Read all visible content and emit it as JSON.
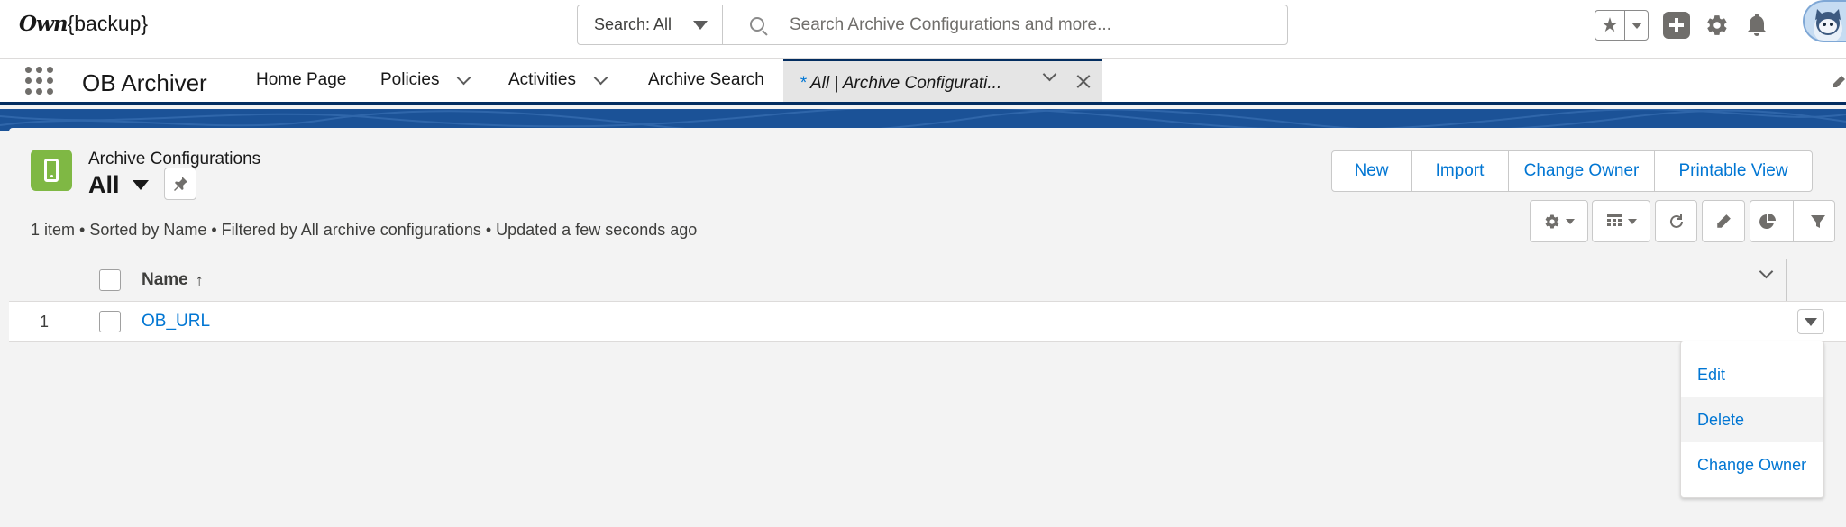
{
  "brand": {
    "logo_own": "Own",
    "logo_backup": "{backup}"
  },
  "search": {
    "scope": "Search: All",
    "placeholder": "Search Archive Configurations and more..."
  },
  "app": {
    "name": "OB Archiver"
  },
  "nav": {
    "items": [
      {
        "label": "Home Page",
        "has_menu": false
      },
      {
        "label": "Policies",
        "has_menu": true
      },
      {
        "label": "Activities",
        "has_menu": true
      },
      {
        "label": "Archive Search",
        "has_menu": false
      }
    ],
    "active_tab": {
      "prefix": "* ",
      "label": "All | Archive Configurati..."
    }
  },
  "list": {
    "object_label": "Archive Configurations",
    "view_name": "All",
    "status": "1 item • Sorted by Name • Filtered by All archive configurations • Updated a few seconds ago",
    "actions": [
      "New",
      "Import",
      "Change Owner",
      "Printable View"
    ],
    "columns": [
      {
        "label": "Name",
        "sort": "↑"
      }
    ],
    "rows": [
      {
        "num": "1",
        "name": "OB_URL"
      }
    ]
  },
  "row_menu": {
    "items": [
      "Edit",
      "Delete",
      "Change Owner"
    ],
    "hovered_index": 1
  },
  "colors": {
    "brand_blue": "#0176d3",
    "nav_dark": "#032d60",
    "band_blue": "#1b5297",
    "object_icon_green": "#7fb844"
  }
}
